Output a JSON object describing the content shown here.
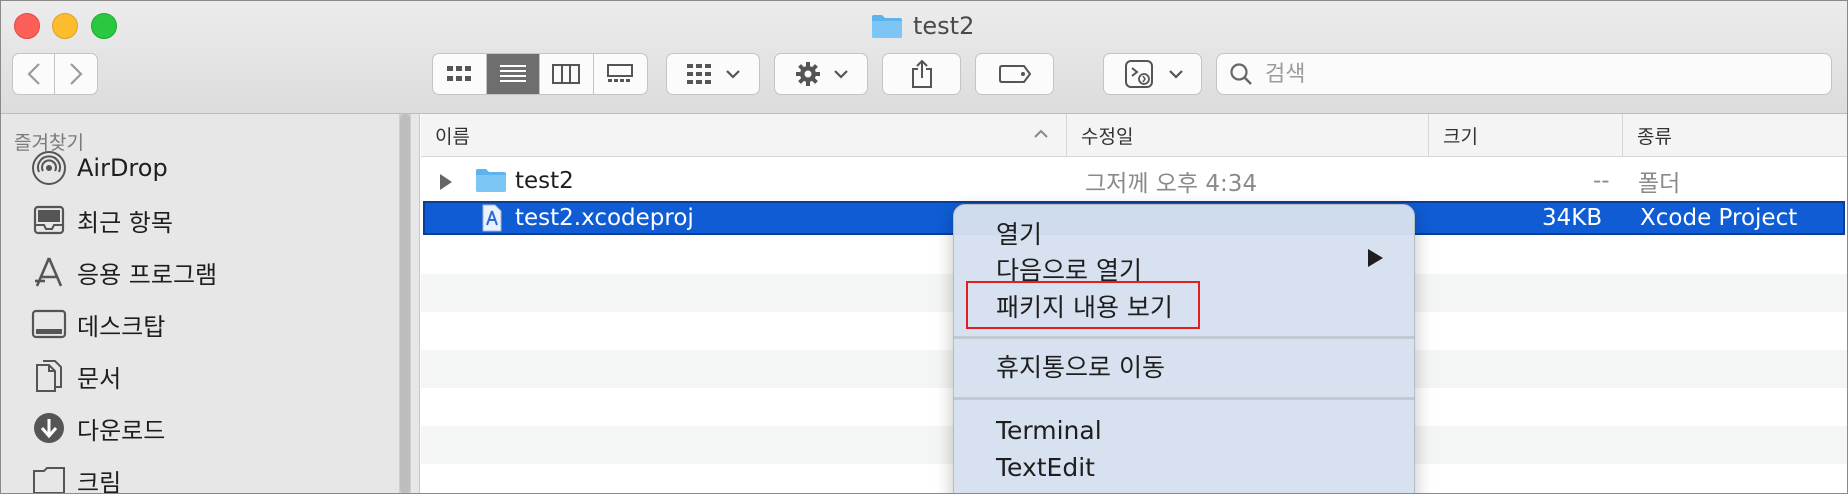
{
  "window": {
    "title": "test2"
  },
  "toolbar": {
    "search_placeholder": "검색"
  },
  "sidebar": {
    "heading": "즐겨찾기",
    "items": [
      {
        "label": "AirDrop",
        "icon": "airdrop-icon"
      },
      {
        "label": "최근 항목",
        "icon": "recents-icon"
      },
      {
        "label": "응용 프로그램",
        "icon": "applications-icon"
      },
      {
        "label": "데스크탑",
        "icon": "desktop-icon"
      },
      {
        "label": "문서",
        "icon": "documents-icon"
      },
      {
        "label": "다운로드",
        "icon": "downloads-icon"
      },
      {
        "label": "크림",
        "icon": "folder-icon"
      }
    ]
  },
  "columns": {
    "name": "이름",
    "modified": "수정일",
    "size": "크기",
    "kind": "종류"
  },
  "files": [
    {
      "name": "test2",
      "modified": "그저께 오후 4:34",
      "size": "--",
      "kind": "폴더"
    },
    {
      "name": "test2.xcodeproj",
      "modified": "",
      "size": "34KB",
      "kind": "Xcode Project"
    }
  ],
  "context_menu": {
    "open": "열기",
    "open_with": "다음으로 열기",
    "show_package_contents": "패키지 내용 보기",
    "move_to_trash": "휴지통으로 이동",
    "terminal": "Terminal",
    "textedit": "TextEdit"
  },
  "colors": {
    "selection": "#0f5cd4",
    "highlight_box": "#e0201f"
  }
}
